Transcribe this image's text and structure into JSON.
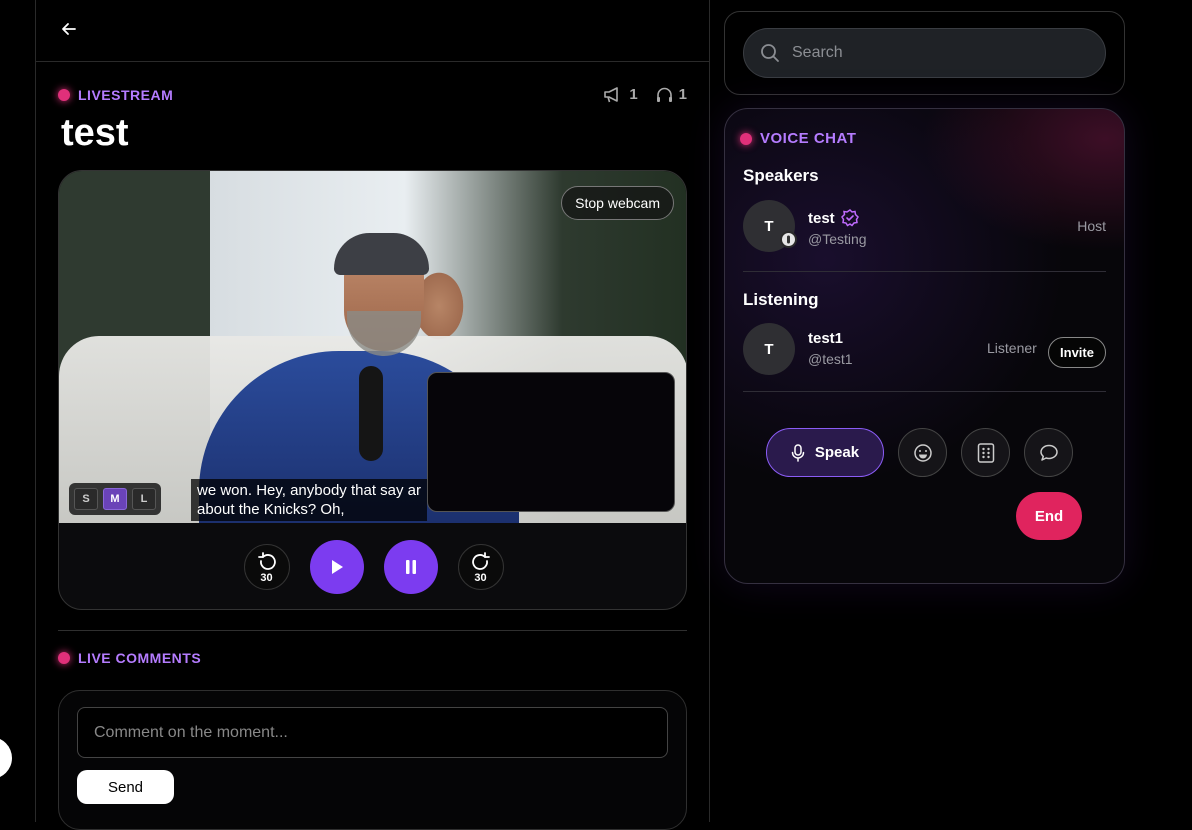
{
  "stream": {
    "label": "LIVESTREAM",
    "title": "test",
    "announcer_count": "1",
    "listener_count": "1"
  },
  "player": {
    "stop_webcam_label": "Stop webcam",
    "caption_sizes": [
      "S",
      "M",
      "L"
    ],
    "caption_size_selected": "M",
    "captions_line1": "we won. Hey, anybody that say ar",
    "captions_line2": "about the Knicks? Oh,",
    "rewind_label": "30",
    "forward_label": "30"
  },
  "comments": {
    "label": "LIVE COMMENTS",
    "placeholder": "Comment on the moment...",
    "send_label": "Send"
  },
  "search": {
    "placeholder": "Search"
  },
  "voice_chat": {
    "label": "VOICE CHAT",
    "speakers_heading": "Speakers",
    "listening_heading": "Listening",
    "speakers": [
      {
        "initial": "T",
        "name": "test",
        "handle": "@Testing",
        "role": "Host"
      }
    ],
    "listeners": [
      {
        "initial": "T",
        "name": "test1",
        "handle": "@test1",
        "role": "Listener",
        "action": "Invite"
      }
    ],
    "speak_label": "Speak",
    "end_label": "End"
  },
  "colors": {
    "accent_purple": "#7c3cf0",
    "label_purple": "#b57cff",
    "live_dot": "#e0307a",
    "end_red": "#e0245e"
  },
  "icons": [
    "back-arrow-icon",
    "megaphone-icon",
    "headphones-icon",
    "search-icon",
    "verified-icon",
    "mic-icon",
    "emoji-icon",
    "grid-icon",
    "chat-bubble-icon",
    "play-icon",
    "pause-icon",
    "rewind-icon",
    "forward-icon"
  ]
}
